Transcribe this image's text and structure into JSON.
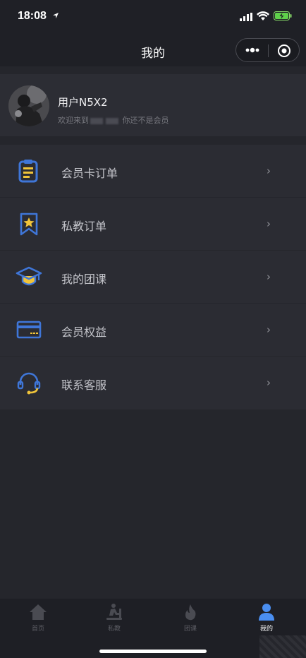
{
  "status": {
    "time": "18:08"
  },
  "nav": {
    "title": "我的"
  },
  "profile": {
    "name": "用户N5X2",
    "welcome_prefix": "欢迎来到",
    "member_status": "你还不是会员"
  },
  "menu": {
    "items": [
      {
        "label": "会员卡订单",
        "icon": "clipboard-icon",
        "chevron": "›"
      },
      {
        "label": "私教订单",
        "icon": "star-bookmark-icon",
        "chevron": "›"
      },
      {
        "label": "我的团课",
        "icon": "graduation-cap-icon",
        "chevron": "›"
      },
      {
        "label": "会员权益",
        "icon": "card-icon",
        "chevron": "›"
      },
      {
        "label": "联系客服",
        "icon": "headset-icon",
        "chevron": "›"
      }
    ]
  },
  "tabs": [
    {
      "label": "首页",
      "icon": "home-icon",
      "active": false
    },
    {
      "label": "私教",
      "icon": "treadmill-icon",
      "active": false
    },
    {
      "label": "团课",
      "icon": "flame-icon",
      "active": false
    },
    {
      "label": "我的",
      "icon": "person-icon",
      "active": true
    }
  ],
  "colors": {
    "background": "#25262c",
    "card": "#2b2c33",
    "icon_blue": "#3f76d8",
    "icon_yellow": "#f0c43a",
    "tab_active": "#4a8ef0",
    "tab_inactive": "#4a4b52"
  }
}
